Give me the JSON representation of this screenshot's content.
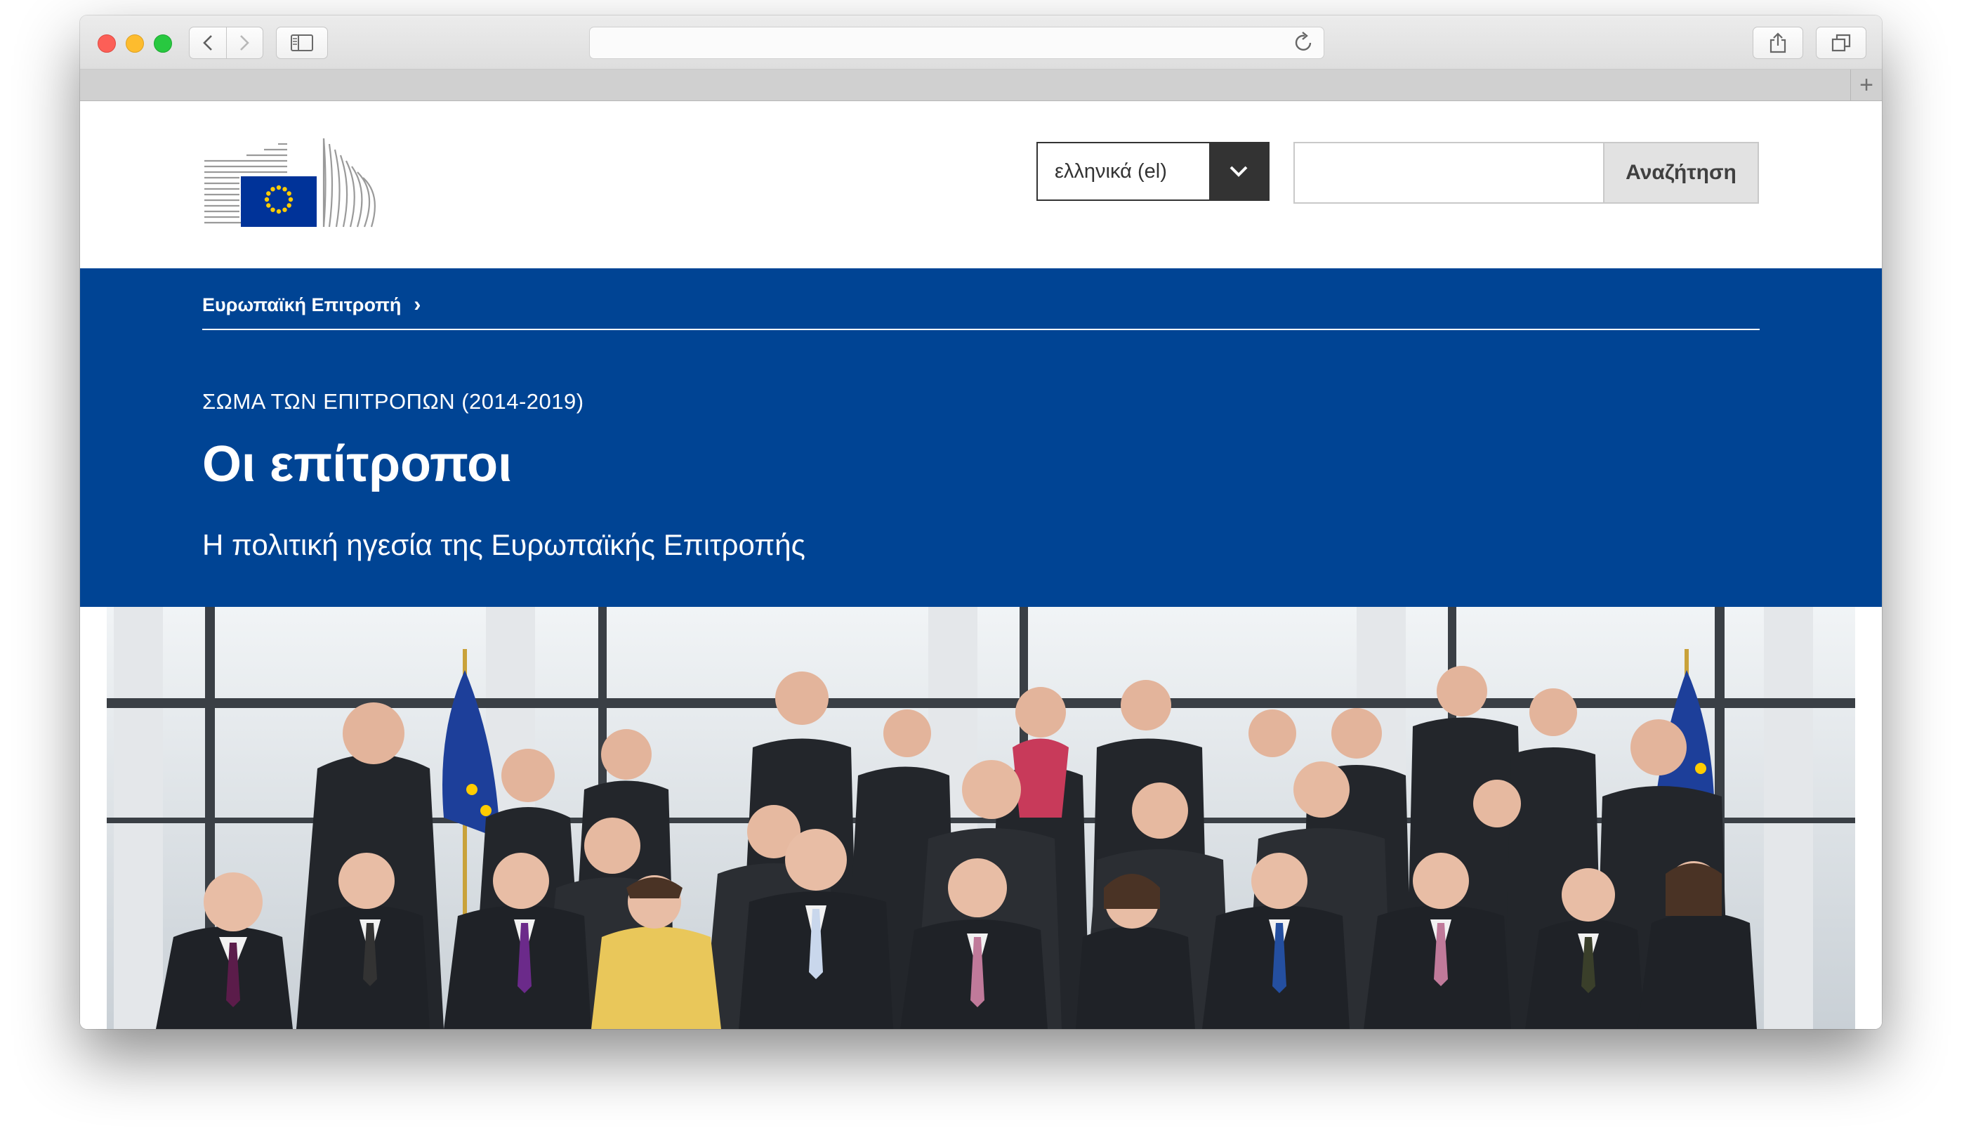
{
  "browser": {
    "address": "",
    "new_tab_symbol": "+"
  },
  "header": {
    "language_selected": "ελληνικά (el)",
    "search_placeholder": "",
    "search_button": "Αναζήτηση"
  },
  "banner": {
    "breadcrumb": "Ευρωπαϊκή Επιτροπή",
    "breadcrumb_separator": "›",
    "kicker": "ΣΩΜΑ ΤΩΝ ΕΠΙΤΡΟΠΩΝ (2014-2019)",
    "title": "Οι επίτροποι",
    "subtitle": "Η πολιτική ηγεσία της Ευρωπαϊκής Επιτροπής"
  },
  "colors": {
    "banner_blue": "#004494",
    "eu_flag_blue": "#003399",
    "eu_star_yellow": "#ffcc00"
  },
  "icons": [
    "back-icon",
    "forward-icon",
    "sidebar-icon",
    "reload-icon",
    "share-icon",
    "tabs-icon",
    "chevron-down-icon",
    "eu-flag-icon"
  ]
}
